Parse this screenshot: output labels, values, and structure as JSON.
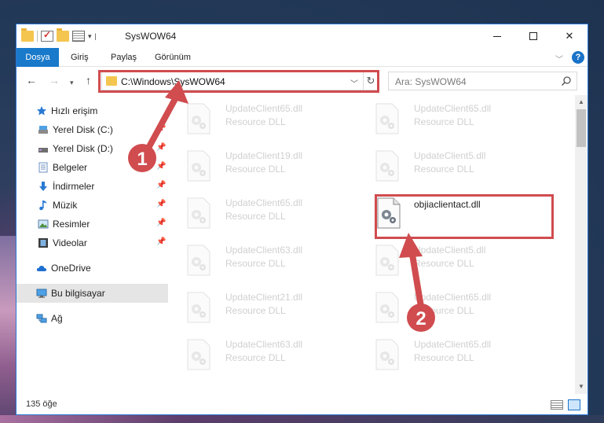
{
  "window": {
    "title": "SysWOW64",
    "controls": {
      "minimize": "–",
      "maximize": "□",
      "close": "✕"
    }
  },
  "ribbon": {
    "tabs": [
      "Dosya",
      "Giriş",
      "Paylaş",
      "Görünüm"
    ],
    "help": "?"
  },
  "navigation": {
    "address": "C:\\Windows\\SysWOW64",
    "search_placeholder": "Ara: SysWOW64"
  },
  "sidebar": {
    "items": [
      {
        "label": "Hızlı erişim",
        "icon": "star-icon"
      },
      {
        "label": "Yerel Disk (C:)",
        "icon": "drive-icon",
        "pinned": true
      },
      {
        "label": "Yerel Disk (D:)",
        "icon": "drive-icon",
        "pinned": true
      },
      {
        "label": "Belgeler",
        "icon": "documents-icon",
        "pinned": true
      },
      {
        "label": "İndirmeler",
        "icon": "download-icon",
        "pinned": true
      },
      {
        "label": "Müzik",
        "icon": "music-icon",
        "pinned": true
      },
      {
        "label": "Resimler",
        "icon": "pictures-icon",
        "pinned": true
      },
      {
        "label": "Videolar",
        "icon": "videos-icon",
        "pinned": true
      },
      {
        "label": "OneDrive",
        "icon": "cloud-icon"
      },
      {
        "label": "Bu bilgisayar",
        "icon": "computer-icon",
        "selected": true
      },
      {
        "label": "Ağ",
        "icon": "network-icon"
      }
    ]
  },
  "files": {
    "left_column": [
      {
        "name": "UpdateClient65.dll",
        "type": "Resource DLL"
      },
      {
        "name": "UpdateClient19.dll",
        "type": "Resource DLL"
      },
      {
        "name": "UpdateClient65.dll",
        "type": "Resource DLL"
      },
      {
        "name": "UpdateClient63.dll",
        "type": "Resource DLL"
      },
      {
        "name": "UpdateClient21.dll",
        "type": "Resource DLL"
      },
      {
        "name": "UpdateClient63.dll",
        "type": "Resource DLL"
      }
    ],
    "right_column": [
      {
        "name": "UpdateClient65.dll",
        "type": "Resource DLL"
      },
      {
        "name": "UpdateClient5.dll",
        "type": "Resource DLL"
      },
      {
        "name": "objiaclientact.dll",
        "type": "",
        "highlighted": true
      },
      {
        "name": "UpdateClient5.dll",
        "type": "Resource DLL"
      },
      {
        "name": "UpdateClient65.dll",
        "type": "Resource DLL"
      },
      {
        "name": "UpdateClient65.dll",
        "type": "Resource DLL"
      }
    ]
  },
  "status": {
    "item_count": "135 öğe"
  },
  "annotations": {
    "step1": "1",
    "step2": "2",
    "color": "#d04c4f"
  }
}
